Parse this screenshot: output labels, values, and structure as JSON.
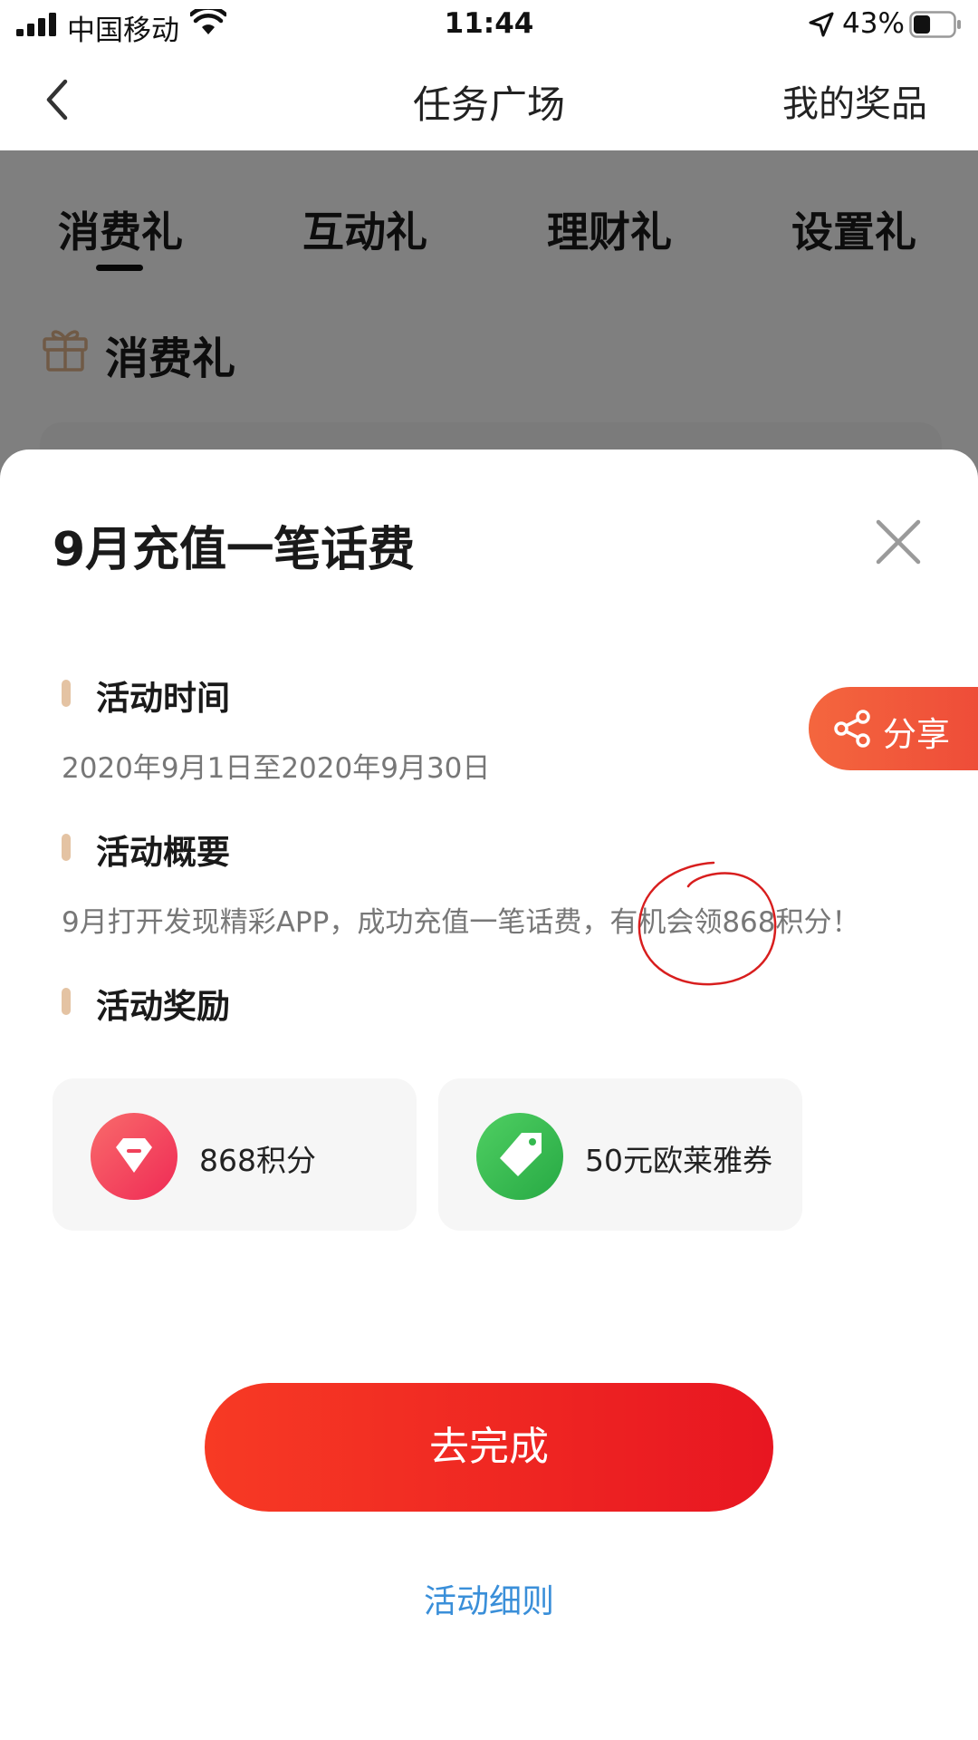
{
  "status_bar": {
    "carrier": "中国移动",
    "time": "11:44",
    "battery": "43%",
    "battery_level": 0.43,
    "icons": [
      "signal-icon",
      "wifi-icon",
      "location-arrow-icon",
      "battery-icon"
    ]
  },
  "nav": {
    "title": "任务广场",
    "my_prizes": "我的奖品",
    "back_icon": "chevron-left-icon"
  },
  "tabs": [
    {
      "label": "消费礼",
      "active": true
    },
    {
      "label": "互动礼",
      "active": false
    },
    {
      "label": "理财礼",
      "active": false
    },
    {
      "label": "设置礼",
      "active": false
    }
  ],
  "section": {
    "title": "消费礼",
    "icon": "gift-icon"
  },
  "sheet": {
    "title": "9月充值一笔话费",
    "close_icon": "close-icon",
    "share_label": "分享",
    "info": [
      {
        "heading": "活动时间",
        "text": "2020年9月1日至2020年9月30日"
      },
      {
        "heading": "活动概要",
        "text": "9月打开发现精彩APP，成功充值一笔话费，有机会领868积分！"
      },
      {
        "heading": "活动奖励",
        "text": ""
      }
    ],
    "rewards": [
      {
        "label": "868积分",
        "icon": "gem-icon"
      },
      {
        "label": "50元欧莱雅券",
        "icon": "coupon-tag-icon"
      }
    ],
    "primary_button": "去完成",
    "rules_link": "活动细则"
  },
  "colors": {
    "accent": "#ee4b38",
    "primary_button": "#f02a22",
    "link": "#3a8fd9",
    "section_marker": "#e4c3a3",
    "annotation": "#d81e1e"
  }
}
